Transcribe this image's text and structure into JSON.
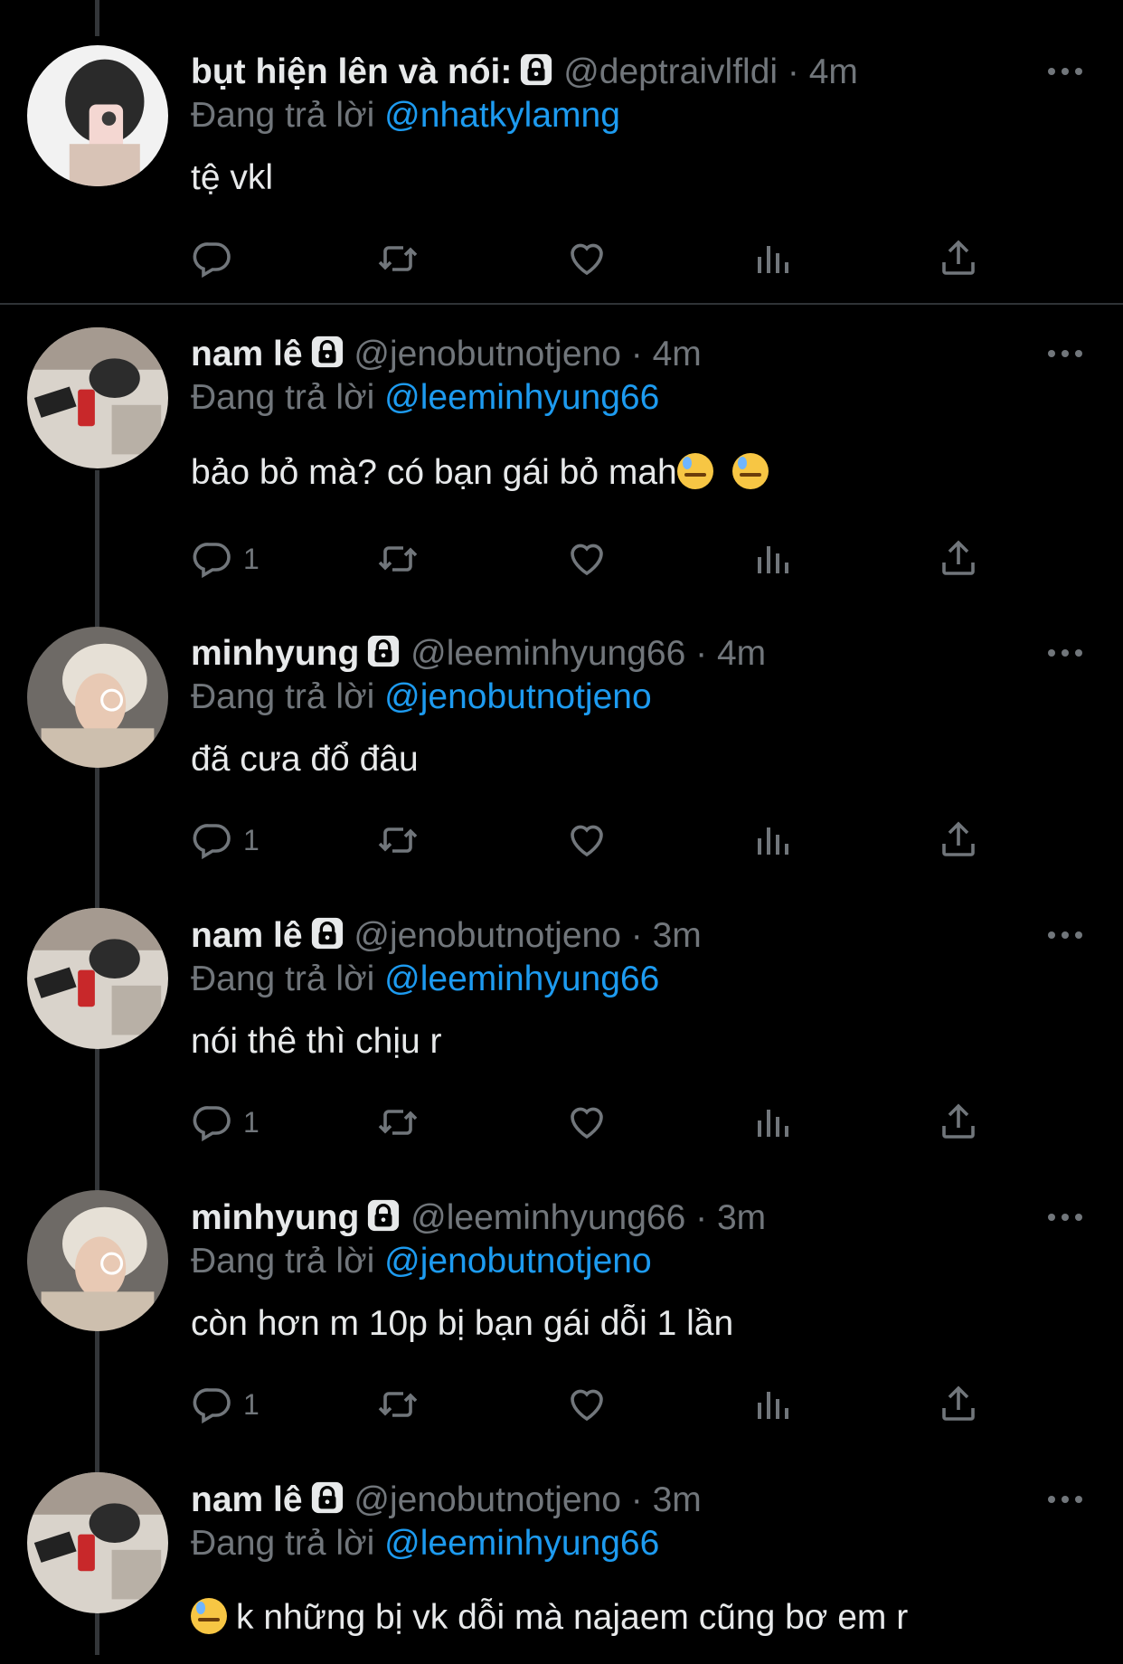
{
  "tweets": [
    {
      "name": "bụt hiện lên và nói:",
      "handle": "@deptraivlfldi",
      "dot": "·",
      "time": "4m",
      "replying_prefix": "Đang trả lời",
      "replying_to": "@nhatkylamng",
      "text": "tệ vkl",
      "reply_count": "",
      "avatar_icon": "avatar-selfie-mirror"
    },
    {
      "name": "nam lê",
      "handle": "@jenobutnotjeno",
      "dot": "·",
      "time": "4m",
      "replying_prefix": "Đang trả lời",
      "replying_to": "@leeminhyung66",
      "text": "bảo bỏ mà? có bạn gái bỏ mah",
      "reply_count": "1",
      "avatar_icon": "avatar-red-phone"
    },
    {
      "name": "minhyung",
      "handle": "@leeminhyung66",
      "dot": "·",
      "time": "4m",
      "replying_prefix": "Đang trả lời",
      "replying_to": "@jenobutnotjeno",
      "text": "đã cưa đổ đâu",
      "reply_count": "1",
      "avatar_icon": "avatar-blond-glasses"
    },
    {
      "name": "nam lê",
      "handle": "@jenobutnotjeno",
      "dot": "·",
      "time": "3m",
      "replying_prefix": "Đang trả lời",
      "replying_to": "@leeminhyung66",
      "text": "nói thê thì chịu r",
      "reply_count": "1",
      "avatar_icon": "avatar-red-phone"
    },
    {
      "name": "minhyung",
      "handle": "@leeminhyung66",
      "dot": "·",
      "time": "3m",
      "replying_prefix": "Đang trả lời",
      "replying_to": "@jenobutnotjeno",
      "text": "còn hơn m 10p bị bạn gái dỗi 1 lần",
      "reply_count": "1",
      "avatar_icon": "avatar-blond-glasses"
    },
    {
      "name": "nam lê",
      "handle": "@jenobutnotjeno",
      "dot": "·",
      "time": "3m",
      "replying_prefix": "Đang trả lời",
      "replying_to": "@leeminhyung66",
      "text": "k những bị vk dỗi mà najaem cũng bơ em r",
      "reply_count": "",
      "avatar_icon": "avatar-red-phone"
    }
  ],
  "icons": {
    "reply": "reply-icon",
    "retweet": "retweet-icon",
    "like": "like-icon",
    "views": "views-icon",
    "share": "share-icon",
    "more": "more-icon",
    "lock": "lock-icon",
    "emoji": "downcast-sweat-face-emoji"
  },
  "colors": {
    "background": "#000000",
    "text": "#e7e9ea",
    "secondary": "#71767b",
    "link": "#1d9bf0",
    "divider": "#2f3336"
  }
}
